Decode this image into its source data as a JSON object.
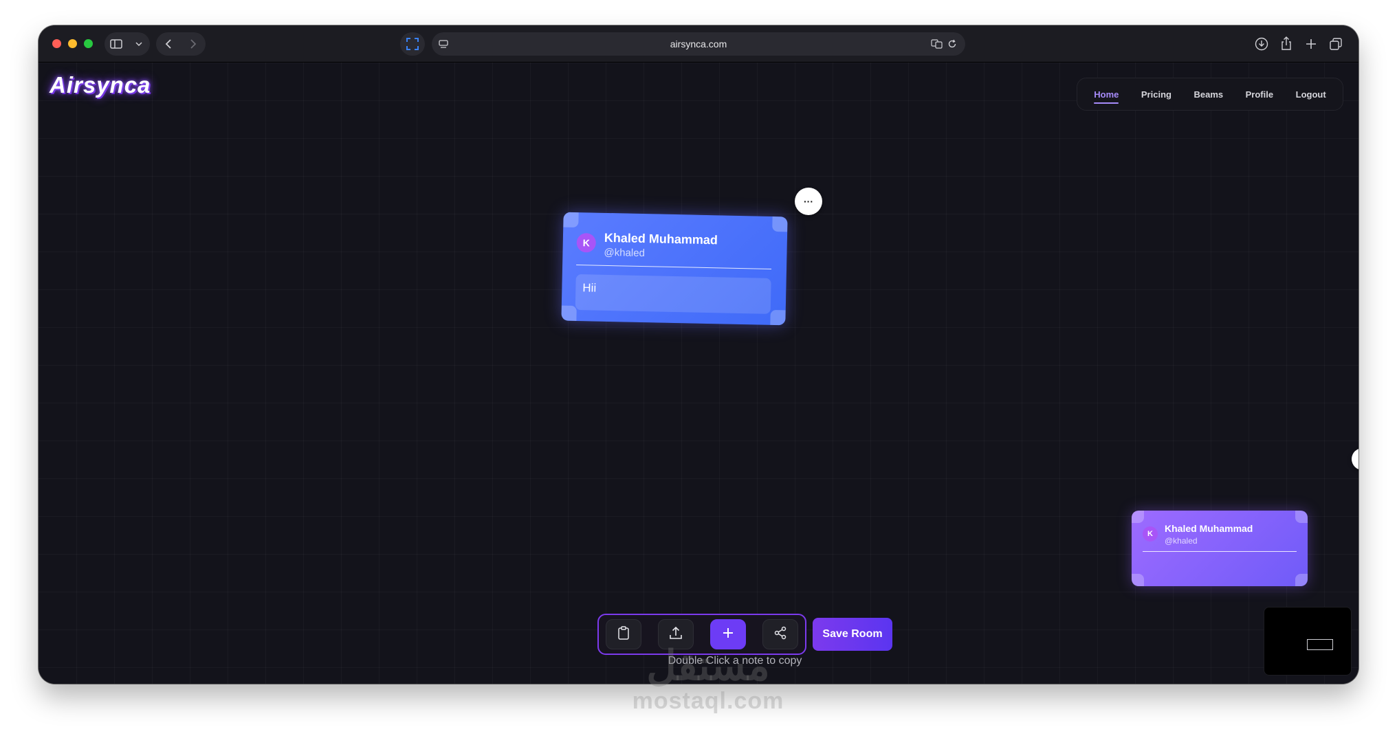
{
  "browser": {
    "url": "airsynca.com",
    "traffic_lights": {
      "close": "#ff5f57",
      "minimize": "#febc2e",
      "zoom": "#28c840"
    }
  },
  "app": {
    "logo": "Airsynca",
    "nav": [
      "Home",
      "Pricing",
      "Beams",
      "Profile",
      "Logout"
    ],
    "active_nav": "Home",
    "accent": "#7c3aed"
  },
  "notes": [
    {
      "avatar": "K",
      "name": "Khaled Muhammad",
      "handle": "@khaled",
      "body": "Hii",
      "color": "#4f7cff"
    },
    {
      "avatar": "K",
      "name": "Khaled Muhammad",
      "handle": "@khaled",
      "body": "",
      "color": "#8b5cf6"
    }
  ],
  "more_button": "···",
  "toolbar": {
    "icons": [
      "clipboard-icon",
      "upload-icon",
      "plus-icon",
      "share-icon"
    ],
    "save_label": "Save Room",
    "hint": "Double Click a note to copy"
  },
  "watermark": {
    "arabic": "مستقل",
    "latin": "mostaql.com"
  }
}
